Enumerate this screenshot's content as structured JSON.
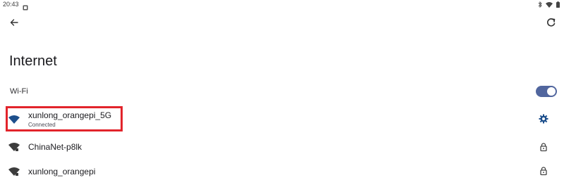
{
  "status_bar": {
    "time": "20:43"
  },
  "page": {
    "title": "Internet"
  },
  "wifi": {
    "label": "Wi-Fi",
    "enabled": true
  },
  "networks": [
    {
      "name": "xunlong_orangepi_5G",
      "status": "Connected",
      "secured": false,
      "action_icon": "gear-icon",
      "icon_color": "#1d4f8c"
    },
    {
      "name": "ChinaNet-p8lk",
      "status": "",
      "secured": true,
      "action_icon": "lock-icon",
      "icon_color": "#3c3c3c"
    },
    {
      "name": "xunlong_orangepi",
      "status": "",
      "secured": true,
      "action_icon": "lock-icon",
      "icon_color": "#3c3c3c"
    }
  ],
  "colors": {
    "accent": "#51669e",
    "highlight": "#e2242b"
  }
}
